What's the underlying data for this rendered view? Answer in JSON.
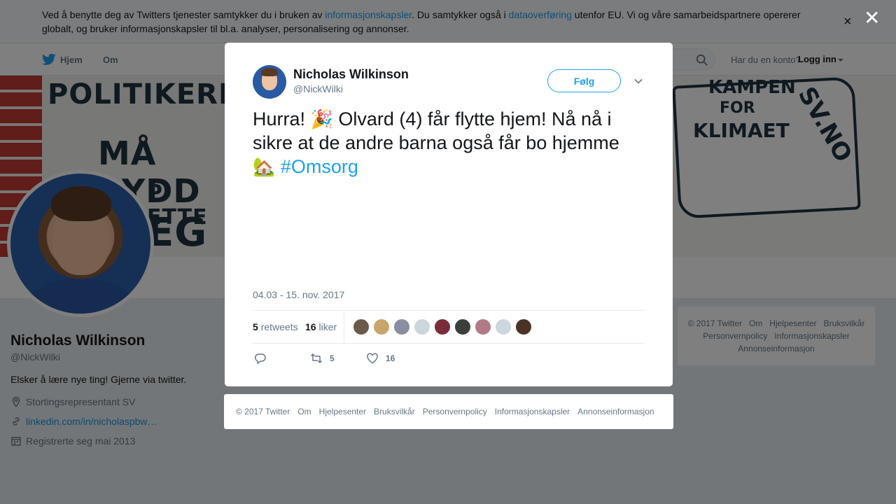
{
  "cookie_bar": {
    "text_part1": "Ved å benytte deg av Twitters tjenester samtykker du i bruken av ",
    "link1": "informasjonskapsler",
    "text_part2": ". Du samtykker også i ",
    "link2": "dataoverføring",
    "text_part3": " utenfor EU. Vi og våre samarbeidspartnere opererer globalt, og bruker informasjonskapsler til bl.a. analyser, personalisering og annonser.",
    "close_glyph": "×"
  },
  "nav": {
    "home_label": "Hjem",
    "about_label": "Om",
    "have_account": "Har du en konto?",
    "login_label": "Logg inn"
  },
  "banner": {
    "line1": "POLITIKERE",
    "line2": "MÅ RYDD",
    "line3": "P ETTE",
    "line4": "EG",
    "book_line1": "KAMPEN",
    "book_line2": "FOR",
    "book_line3": "KLIMAET",
    "book_line4": "SV.NO"
  },
  "profile": {
    "name": "Nicholas Wilkinson",
    "handle": "@NickWilki",
    "bio": "Elsker å lære nye ting! Gjerne via twitter.",
    "location": "Stortingsrepresentant SV",
    "url": "linkedin.com/in/nicholaspbw…",
    "joined": "Registrerte seg mai 2013"
  },
  "side_footer": {
    "items": [
      "© 2017 Twitter",
      "Om",
      "Hjelpesenter",
      "Bruksvilkår",
      "Personvernpolicy",
      "Informasjonskapsler",
      "Annonseinformasjon"
    ]
  },
  "overlay": {
    "close_glyph": "✕"
  },
  "tweet": {
    "author_name": "Nicholas Wilkinson",
    "author_handle": "@NickWilki",
    "follow_label": "Følg",
    "text_before_emoji1": "Hurra! ",
    "emoji1": "🎉",
    "text_main": " Olvard (4) får flytte hjem! Nå nå i sikre at de andre barna også får bo hjemme ",
    "emoji2": "🏡",
    "hashtag": "#Omsorg",
    "timestamp": "04.03 - 15. nov. 2017",
    "retweets_count": "5",
    "retweets_label": "retweets",
    "likes_count": "16",
    "likes_label": "liker",
    "action_retweet_count": "5",
    "action_like_count": "16",
    "liker_colors": [
      "#6b5a4a",
      "#c9a56b",
      "#8a8fa0",
      "#ccd6dd",
      "#7a2c3a",
      "#3a3f3a",
      "#b07a86",
      "#ccd6dd",
      "#4a3322"
    ]
  },
  "modal_footer": {
    "items": [
      "© 2017 Twitter",
      "Om",
      "Hjelpesenter",
      "Bruksvilkår",
      "Personvernpolicy",
      "Informasjonskapsler",
      "Annonseinformasjon"
    ]
  }
}
